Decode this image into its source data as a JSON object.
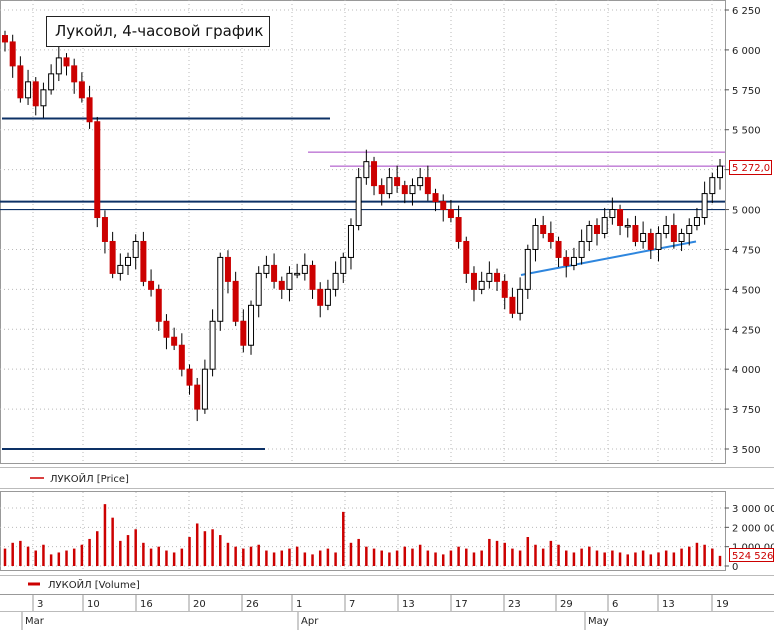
{
  "title": "Лукойл, 4-часовой график",
  "price_legend": "ЛУКОЙЛ [Price]",
  "volume_legend": "ЛУКОЙЛ [Volume]",
  "last_price_label": "5 272,0",
  "last_volume_label": "524 526",
  "colors": {
    "candle": "#cc0000",
    "support": "#0d3166",
    "trendline": "#2e86de",
    "resistance": "#a341c4",
    "label_border": "#cc0000",
    "grid": "#b9b9b9"
  },
  "price_axis": {
    "ticks": [
      "6 250",
      "6 000",
      "5 750",
      "5 500",
      "5 250",
      "5 000",
      "4 750",
      "4 500",
      "4 250",
      "4 000",
      "3 750",
      "3 500"
    ]
  },
  "volume_axis": {
    "ticks": [
      "3 000 000",
      "2 000 000",
      "1 000 000",
      "0"
    ]
  },
  "date_axis": {
    "days": [
      "3",
      "10",
      "16",
      "20",
      "26",
      "1",
      "7",
      "13",
      "17",
      "23",
      "29",
      "6",
      "13",
      "19"
    ],
    "months": [
      "Mar",
      "Apr",
      "May"
    ]
  },
  "chart_data": {
    "type": "candlestick",
    "title": "Лукойл, 4-часовой график",
    "series": [
      {
        "name": "ЛУКОЙЛ [Price]",
        "representative_close": [
          6050,
          5900,
          5700,
          5800,
          5650,
          5750,
          5850,
          5950,
          5900,
          5800,
          5700,
          5550,
          4950,
          4800,
          4600,
          4650,
          4700,
          4800,
          4550,
          4500,
          4300,
          4200,
          4150,
          4000,
          3900,
          3750,
          4000,
          4300,
          4700,
          4550,
          4300,
          4150,
          4400,
          4600,
          4650,
          4550,
          4500,
          4600,
          4600,
          4650,
          4500,
          4400,
          4500,
          4600,
          4700,
          4900,
          5200,
          5300,
          5150,
          5100,
          5200,
          5150,
          5100,
          5150,
          5200,
          5100,
          5050,
          5000,
          4950,
          4800,
          4600,
          4500,
          4550,
          4600,
          4550,
          4450,
          4350,
          4500,
          4750,
          4900,
          4850,
          4800,
          4700,
          4650,
          4700,
          4800,
          4900,
          4850,
          4950,
          5000,
          4900,
          4900,
          4800,
          4850,
          4750,
          4850,
          4900,
          4800,
          4850,
          4900,
          4950,
          5100,
          5200,
          5272
        ]
      },
      {
        "name": "ЛУКОЙЛ [Volume]",
        "representative_volume_millions": [
          0.9,
          1.2,
          1.3,
          1.0,
          0.8,
          1.1,
          0.6,
          0.7,
          0.8,
          0.9,
          1.1,
          1.4,
          1.8,
          3.2,
          2.5,
          1.3,
          1.6,
          1.9,
          1.2,
          0.9,
          1.0,
          0.8,
          0.7,
          0.9,
          1.5,
          2.2,
          1.8,
          1.9,
          1.6,
          1.2,
          1.0,
          0.9,
          1.0,
          1.1,
          0.8,
          0.7,
          0.8,
          0.9,
          1.0,
          0.7,
          0.6,
          0.8,
          0.9,
          0.7,
          2.8,
          1.2,
          1.4,
          1.0,
          0.9,
          0.8,
          0.7,
          0.8,
          1.0,
          0.9,
          1.1,
          0.8,
          0.7,
          0.6,
          0.8,
          1.0,
          0.9,
          0.7,
          0.8,
          1.4,
          1.3,
          1.2,
          0.9,
          0.8,
          1.5,
          1.1,
          0.9,
          1.3,
          1.1,
          0.8,
          0.7,
          0.9,
          1.0,
          0.8,
          0.7,
          0.8,
          0.7,
          0.6,
          0.7,
          0.8,
          0.6,
          0.7,
          0.8,
          0.7,
          0.9,
          1.0,
          1.2,
          1.1,
          0.9,
          0.524526
        ]
      }
    ],
    "horizontal_levels": [
      5570,
      5050,
      5000,
      3500
    ],
    "resistance_levels": [
      5360,
      5272
    ],
    "trendline": {
      "from": [
        "Apr 25",
        4590
      ],
      "to": [
        "May 17",
        4800
      ]
    },
    "y_range": [
      3400,
      6300
    ],
    "volume_range": [
      0,
      3200000
    ],
    "grid": true
  }
}
